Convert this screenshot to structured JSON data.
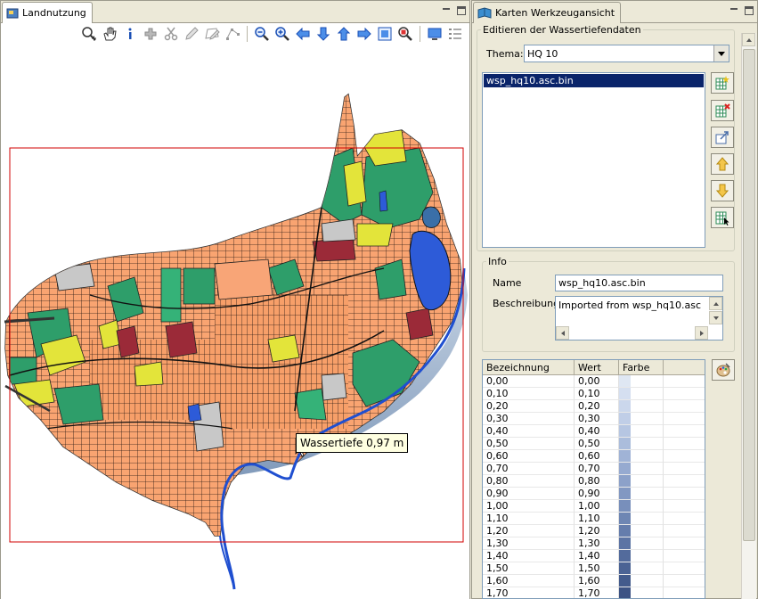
{
  "left_view": {
    "tab_title": "Landnutzung",
    "tooltip": "Wassertiefe 0,97 m",
    "toolbar_icons": [
      "zoom-in-icon",
      "pan-hand-icon",
      "info-icon",
      "add-point-icon",
      "scissors-icon",
      "pencil-icon",
      "edit-polygon-icon",
      "select-vertex-icon",
      "zoom-out-icon",
      "zoom-in-plus-icon",
      "pan-left-icon",
      "pan-down-icon",
      "pan-up-icon",
      "pan-right-icon",
      "full-extent-icon",
      "zoom-layer-icon",
      "monitor-icon",
      "list-icon"
    ]
  },
  "right_view": {
    "tab_title": "Karten Werkzeugansicht",
    "group_edit": "Editieren der Wassertiefendaten",
    "thema_label": "Thema:",
    "thema_value": "HQ 10",
    "list_items": [
      "wsp_hq10.asc.bin"
    ],
    "info_group": "Info",
    "name_label": "Name",
    "name_value": "wsp_hq10.asc.bin",
    "beschreibung_label": "Beschreibung",
    "beschreibung_value": "Imported from wsp_hq10.asc",
    "table": {
      "headers": [
        "Bezeichnung",
        "Wert",
        "Farbe"
      ],
      "rows": [
        {
          "bez": "0,00",
          "wert": "0,00",
          "color": "#dfe7f3"
        },
        {
          "bez": "0,10",
          "wert": "0,10",
          "color": "#d5dff0"
        },
        {
          "bez": "0,20",
          "wert": "0,20",
          "color": "#cbd7ec"
        },
        {
          "bez": "0,30",
          "wert": "0,30",
          "color": "#c0cee7"
        },
        {
          "bez": "0,40",
          "wert": "0,40",
          "color": "#b6c6e2"
        },
        {
          "bez": "0,50",
          "wert": "0,50",
          "color": "#abbddc"
        },
        {
          "bez": "0,60",
          "wert": "0,60",
          "color": "#a0b3d6"
        },
        {
          "bez": "0,70",
          "wert": "0,70",
          "color": "#96aad0"
        },
        {
          "bez": "0,80",
          "wert": "0,80",
          "color": "#8ca1c9"
        },
        {
          "bez": "0,90",
          "wert": "0,90",
          "color": "#8298c2"
        },
        {
          "bez": "1,00",
          "wert": "1,00",
          "color": "#788fbb"
        },
        {
          "bez": "1,10",
          "wert": "1,10",
          "color": "#6e86b3"
        },
        {
          "bez": "1,20",
          "wert": "1,20",
          "color": "#657dac"
        },
        {
          "bez": "1,30",
          "wert": "1,30",
          "color": "#5c74a4"
        },
        {
          "bez": "1,40",
          "wert": "1,40",
          "color": "#536b9c"
        },
        {
          "bez": "1,50",
          "wert": "1,50",
          "color": "#4b6394"
        },
        {
          "bez": "1,60",
          "wert": "1,60",
          "color": "#435b8c"
        },
        {
          "bez": "1,70",
          "wert": "1,70",
          "color": "#3c5384"
        }
      ]
    }
  },
  "colors": {
    "selection": "#0a246a",
    "landuse_orange": "#f9a471",
    "landuse_green": "#2e9e6a",
    "landuse_yellow": "#e3e43a",
    "landuse_red": "#9b2a38",
    "landuse_gray": "#c8c8c8",
    "water": "#2d5bd8",
    "extent_frame": "#d20000"
  }
}
